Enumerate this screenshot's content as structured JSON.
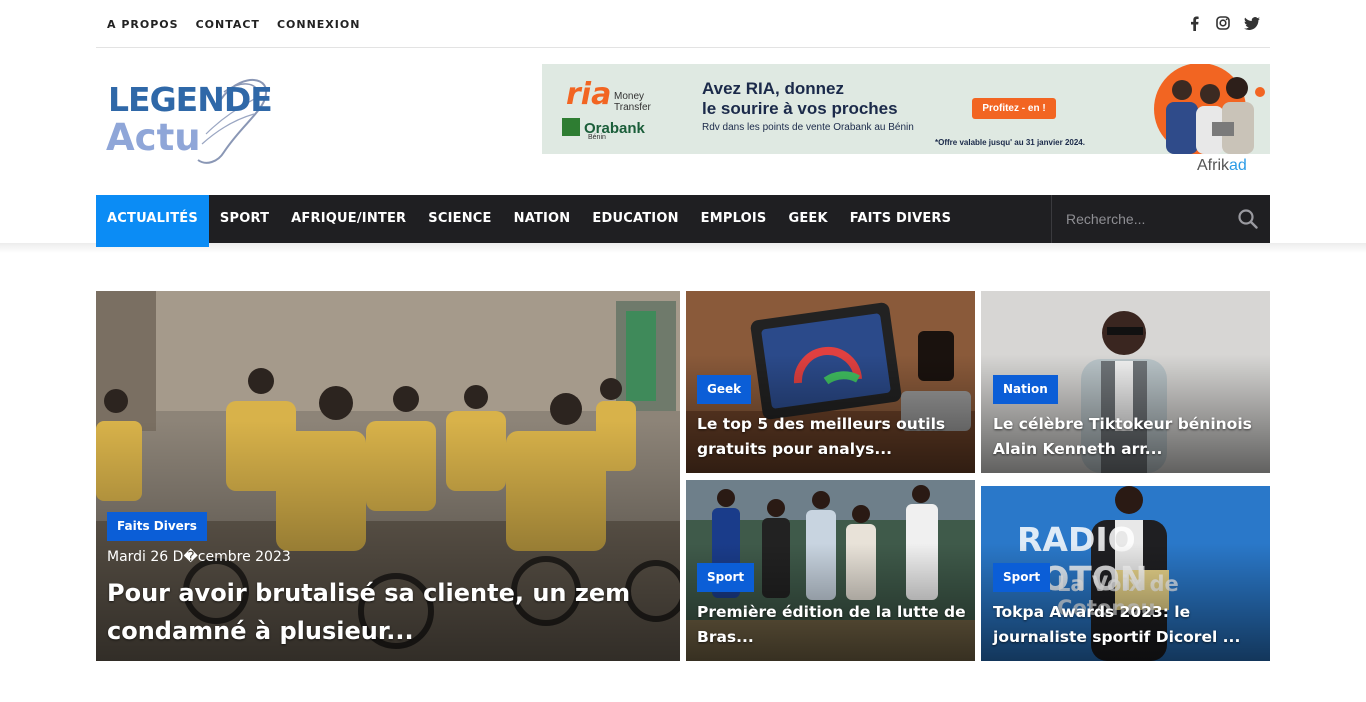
{
  "topbar": {
    "links": [
      "A PROPOS",
      "CONTACT",
      "CONNEXION"
    ],
    "social_icons": [
      "facebook-icon",
      "instagram-icon",
      "twitter-icon"
    ]
  },
  "logo": {
    "line1": "LEGENDE",
    "line2": "Actu"
  },
  "ad": {
    "brand": "ria",
    "brand_sub": "Money Transfer",
    "partner": "Orabank",
    "partner_sub": "Bénin",
    "headline_1": "Avez RIA, donnez",
    "headline_2": "le sourire à vos proches",
    "subline": "Rdv dans les points de vente Orabank au Bénin",
    "cta": "Profitez - en !",
    "offer": "*Offre valable jusqu' au 31 janvier 2024.",
    "network_a": "Afrik",
    "network_b": "ad"
  },
  "nav": {
    "items": [
      "ACTUALITÉS",
      "SPORT",
      "AFRIQUE/INTER",
      "SCIENCE",
      "NATION",
      "EDUCATION",
      "EMPLOIS",
      "GEEK",
      "FAITS DIVERS"
    ],
    "active": "ACTUALITÉS",
    "search_placeholder": "Recherche..."
  },
  "colors": {
    "accent": "#0b8cf5",
    "nav_bg": "#1f1f22",
    "badge": "#0b5ed7"
  },
  "featured": {
    "category": "Faits Divers",
    "date": "Mardi 26 D�cembre 2023",
    "title": "Pour avoir brutalisé sa cliente, un zem condamné à plusieur..."
  },
  "cards": [
    {
      "category": "Geek",
      "title": "Le top 5 des meilleurs outils gratuits pour analys..."
    },
    {
      "category": "Nation",
      "title": "Le célèbre Tiktokeur béninois Alain Kenneth arr..."
    },
    {
      "category": "Sport",
      "title": "Première édition de la lutte de Bras..."
    },
    {
      "category": "Sport",
      "title": "Tokpa Awards 2023: le journaliste sportif Dicorel ..."
    }
  ]
}
